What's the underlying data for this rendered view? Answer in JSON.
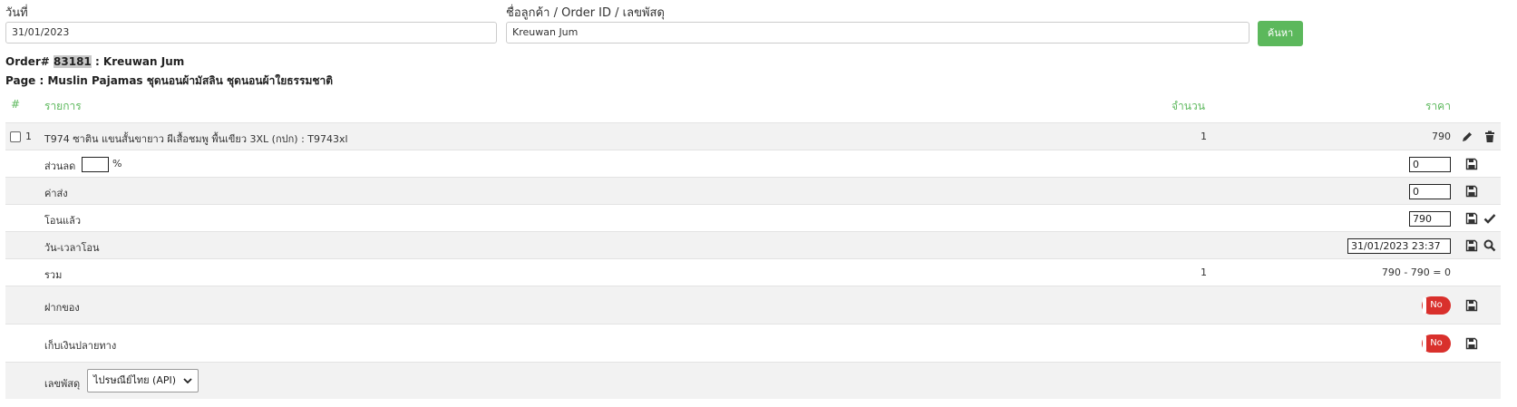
{
  "search": {
    "date_label": "วันที่",
    "date_value": "31/01/2023",
    "customer_label": "ชื่อลูกค้า / Order ID / เลขพัสดุ",
    "customer_value": "Kreuwan Jum",
    "search_button": "ค้นหา"
  },
  "order": {
    "prefix": "Order#",
    "id": "83181",
    "customer": ": Kreuwan Jum",
    "page_line": "Page : Muslin Pajamas ชุดนอนผ้ามัสลิน ชุดนอนผ้าใยธรรมชาติ"
  },
  "table": {
    "headers": {
      "num": "#",
      "item": "รายการ",
      "qty": "จำนวน",
      "price": "ราคา"
    },
    "item": {
      "index": "1",
      "name": "T974 ซาติน แขนสั้นขายาว ผีเสื้อชมพู พื้นเขียว 3XL (กปก) : T9743xl",
      "qty": "1",
      "price": "790"
    },
    "discount": {
      "label": "ส่วนลด",
      "unit": "%",
      "percent_value": "",
      "value": "0"
    },
    "shipping": {
      "label": "ค่าส่ง",
      "value": "0"
    },
    "paid": {
      "label": "โอนแล้ว",
      "value": "790"
    },
    "transfer_time": {
      "label": "วัน-เวลาโอน",
      "value": "31/01/2023 23:37"
    },
    "total": {
      "label": "รวม",
      "qty": "1",
      "value": "790 - 790 = 0"
    },
    "deposit": {
      "label": "ฝากของ",
      "toggle": "No"
    },
    "cod": {
      "label": "เก็บเงินปลายทาง",
      "toggle": "No"
    },
    "tracking": {
      "label": "เลขพัสดุ",
      "carrier": "ไปรษณีย์ไทย (API)"
    }
  },
  "colors": {
    "accent_green": "#5cb85c",
    "toggle_red": "#d9302c",
    "row_gray": "#f2f2f2"
  },
  "icons": [
    "checkbox",
    "pencil-icon",
    "trash-icon",
    "save-icon",
    "check-icon",
    "search-icon",
    "chevron-down-icon"
  ]
}
